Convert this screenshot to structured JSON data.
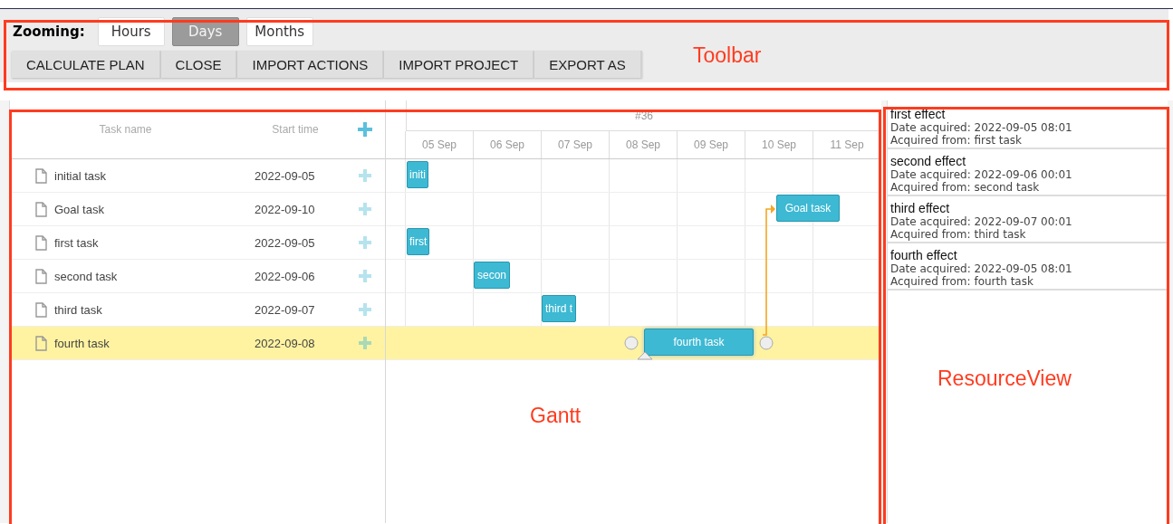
{
  "toolbar": {
    "zoom_label": "Zooming:",
    "zoom_options": [
      {
        "label": "Hours",
        "selected": false
      },
      {
        "label": "Days",
        "selected": true
      },
      {
        "label": "Months",
        "selected": false
      }
    ],
    "actions": [
      "CALCULATE PLAN",
      "CLOSE",
      "IMPORT ACTIONS",
      "IMPORT PROJECT",
      "EXPORT AS"
    ]
  },
  "gantt": {
    "columns": [
      "Task name",
      "Start time"
    ],
    "scale_week": "#36",
    "scale_days": [
      "05 Sep",
      "06 Sep",
      "07 Sep",
      "08 Sep",
      "09 Sep",
      "10 Sep",
      "11 Sep"
    ],
    "rows": [
      {
        "name": "initial task",
        "start_time": "2022-09-05",
        "bar_label": "initi",
        "selected": false
      },
      {
        "name": "Goal task",
        "start_time": "2022-09-10",
        "bar_label": "Goal task",
        "selected": false
      },
      {
        "name": "first task",
        "start_time": "2022-09-05",
        "bar_label": "first",
        "selected": false
      },
      {
        "name": "second task",
        "start_time": "2022-09-06",
        "bar_label": "secon",
        "selected": false
      },
      {
        "name": "third task",
        "start_time": "2022-09-07",
        "bar_label": "third t",
        "selected": false
      },
      {
        "name": "fourth task",
        "start_time": "2022-09-08",
        "bar_label": "fourth task",
        "selected": true
      }
    ]
  },
  "resource_view": {
    "items": [
      {
        "title": "first effect",
        "date": "Date acquired: 2022-09-05 08:01",
        "source": "Acquired from: first task"
      },
      {
        "title": "second effect",
        "date": "Date acquired: 2022-09-06 00:01",
        "source": "Acquired from: second task"
      },
      {
        "title": "third effect",
        "date": "Date acquired: 2022-09-07 00:01",
        "source": "Acquired from: third task"
      },
      {
        "title": "fourth effect",
        "date": "Date acquired: 2022-09-05 08:01",
        "source": "Acquired from: fourth task"
      }
    ]
  },
  "annotations": [
    {
      "label": "Toolbar"
    },
    {
      "label": "Gantt"
    },
    {
      "label": "ResourceView"
    }
  ]
}
